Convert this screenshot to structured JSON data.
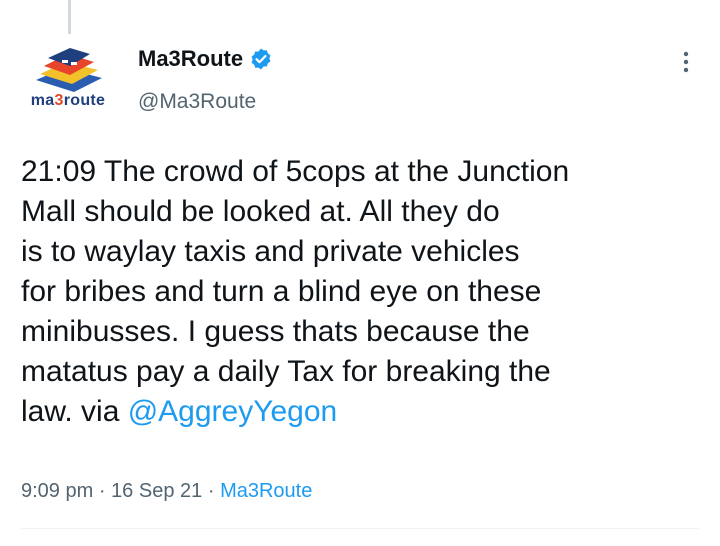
{
  "tweet": {
    "author": {
      "display_name": "Ma3Route",
      "handle": "@Ma3Route",
      "verified": true,
      "avatar_icon": "ma3route-logo-icon",
      "avatar_wordmark": {
        "part1": "ma",
        "accent": "3",
        "part2": "route"
      }
    },
    "text_lines": [
      "21:09 The crowd of 5cops at the Junction",
      "Mall should be looked at. All they do",
      "is to waylay taxis and private vehicles",
      "for bribes and turn a blind eye on these",
      "minibusses. I guess thats because the",
      "matatus pay a daily Tax for breaking the",
      "law. via "
    ],
    "mention": "@AggreyYegon",
    "time": "9:09 pm",
    "separator": "·",
    "date": "16 Sep 21",
    "source": "Ma3Route",
    "more_icon": "more-vertical-icon"
  },
  "colors": {
    "text": "#0f1419",
    "secondary": "#536471",
    "link": "#1d9bf0",
    "verified": "#1d9bf0"
  }
}
